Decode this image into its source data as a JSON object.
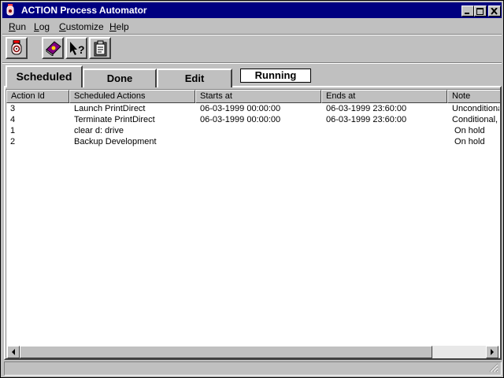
{
  "window": {
    "title": "ACTION Process Automator"
  },
  "title_buttons": [
    "minimize-icon",
    "maximize-icon",
    "close-icon"
  ],
  "menu": [
    {
      "label": "Run",
      "key": "R",
      "rest": "un"
    },
    {
      "label": "Log",
      "key": "L",
      "rest": "og"
    },
    {
      "label": "Customize",
      "key": "C",
      "rest": "ustomize"
    },
    {
      "label": "Help",
      "key": "H",
      "rest": "elp"
    }
  ],
  "toolbar": {
    "icons": [
      "alarm-clock-icon",
      "book-icon",
      "help-pointer-icon",
      "clipboard-icon"
    ]
  },
  "tabs": {
    "scheduled": "Scheduled",
    "done": "Done",
    "edit": "Edit",
    "active": "Scheduled"
  },
  "status": {
    "running": "Running"
  },
  "table": {
    "columns": [
      "Action Id",
      "Scheduled Actions",
      "Starts at",
      "Ends at",
      "Note"
    ],
    "rows": [
      [
        "3",
        "Launch PrintDirect",
        "06-03-1999 00:00:00",
        "06-03-1999 23:60:00",
        "Unconditional"
      ],
      [
        "4",
        "Terminate PrintDirect",
        "06-03-1999 00:00:00",
        "06-03-1999 23:60:00",
        "Conditional, must"
      ],
      [
        "1",
        "clear d: drive",
        "",
        "",
        " On hold"
      ],
      [
        "2",
        "Backup Development",
        "",
        "",
        " On hold"
      ]
    ]
  },
  "colors": {
    "titlebar": "#000080",
    "face": "#c0c0c0",
    "list_bg": "#ffffff"
  }
}
